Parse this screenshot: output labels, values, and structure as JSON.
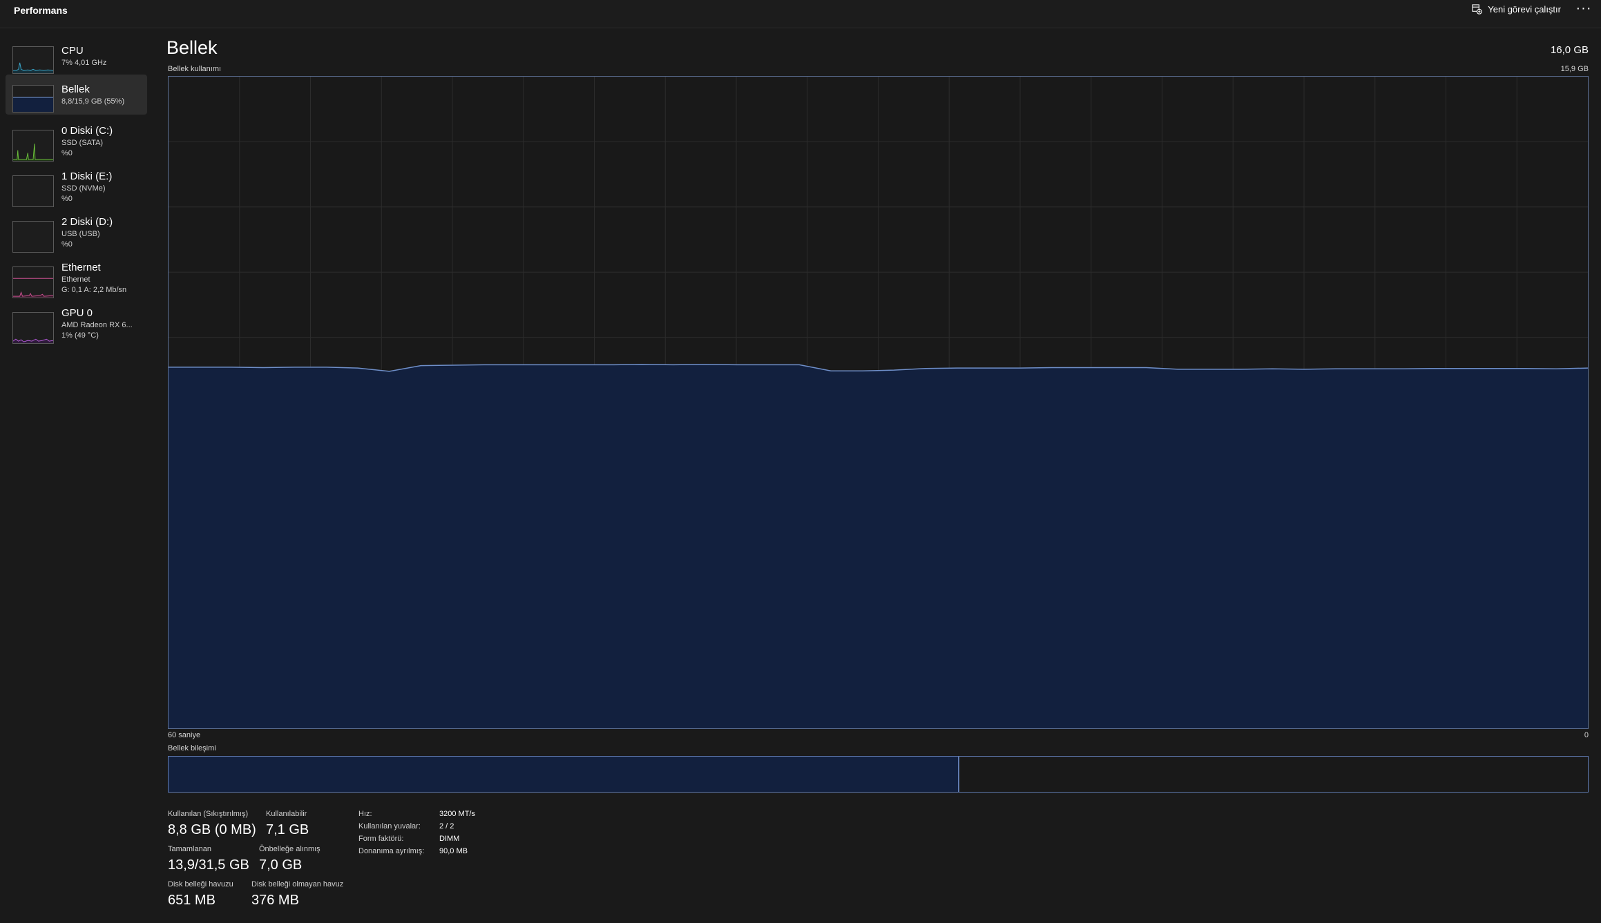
{
  "header": {
    "title": "Performans",
    "run_task_label": "Yeni görevi çalıştır",
    "more_label": "···"
  },
  "sidebar": {
    "items": [
      {
        "name": "CPU",
        "line1": "7% 4,01 GHz",
        "line2": ""
      },
      {
        "name": "Bellek",
        "line1": "8,8/15,9 GB (55%)",
        "line2": ""
      },
      {
        "name": "0 Diski (C:)",
        "line1": "SSD (SATA)",
        "line2": "%0"
      },
      {
        "name": "1 Diski (E:)",
        "line1": "SSD (NVMe)",
        "line2": "%0"
      },
      {
        "name": "2 Diski (D:)",
        "line1": "USB (USB)",
        "line2": "%0"
      },
      {
        "name": "Ethernet",
        "line1": "Ethernet",
        "line2": "G: 0,1 A: 2,2 Mb/sn"
      },
      {
        "name": "GPU 0",
        "line1": "AMD Radeon RX 6...",
        "line2": "1% (49 °C)"
      }
    ]
  },
  "main": {
    "title": "Bellek",
    "total": "16,0 GB",
    "chart_label": "Bellek kullanımı",
    "chart_max": "15,9 GB",
    "axis_left": "60 saniye",
    "axis_right": "0",
    "composition_label": "Bellek bileşimi",
    "composition_used_fraction": 0.557
  },
  "chart_data": {
    "type": "area",
    "ylabel": "Bellek kullanımı",
    "ylim": [
      0,
      15.9
    ],
    "xlim": [
      60,
      0
    ],
    "grid": true,
    "series": [
      {
        "values": [
          8.81,
          8.81,
          8.81,
          8.8,
          8.81,
          8.81,
          8.79,
          8.71,
          8.85,
          8.86,
          8.87,
          8.87,
          8.87,
          8.87,
          8.87,
          8.88,
          8.87,
          8.88,
          8.87,
          8.87,
          8.87,
          8.72,
          8.72,
          8.74,
          8.78,
          8.79,
          8.79,
          8.79,
          8.8,
          8.8,
          8.8,
          8.8,
          8.76,
          8.76,
          8.76,
          8.77,
          8.76,
          8.77,
          8.77,
          8.77,
          8.78,
          8.78,
          8.78,
          8.78,
          8.77,
          8.79
        ]
      }
    ]
  },
  "stats": {
    "in_use_label": "Kullanılan (Sıkıştırılmış)",
    "in_use_value": "8,8 GB (0 MB)",
    "available_label": "Kullanılabilir",
    "available_value": "7,1 GB",
    "committed_label": "Tamamlanan",
    "committed_value": "13,9/31,5 GB",
    "cached_label": "Önbelleğe alınmış",
    "cached_value": "7,0 GB",
    "paged_label": "Disk belleği havuzu",
    "paged_value": "651 MB",
    "nonpaged_label": "Disk belleği olmayan havuz",
    "nonpaged_value": "376 MB"
  },
  "specs": {
    "speed_label": "Hız:",
    "speed_value": "3200 MT/s",
    "slots_label": "Kullanılan yuvalar:",
    "slots_value": "2 / 2",
    "form_label": "Form faktörü:",
    "form_value": "DIMM",
    "reserved_label": "Donanıma ayrılmış:",
    "reserved_value": "90,0 MB"
  },
  "colors": {
    "background": "#1a1a1a",
    "memory_fill": "#12203e",
    "memory_line": "#6f8fc9",
    "cpu": "#3aa6c9",
    "disk": "#6bbf3a",
    "ethernet": "#c8508f",
    "gpu": "#b25ad6"
  }
}
